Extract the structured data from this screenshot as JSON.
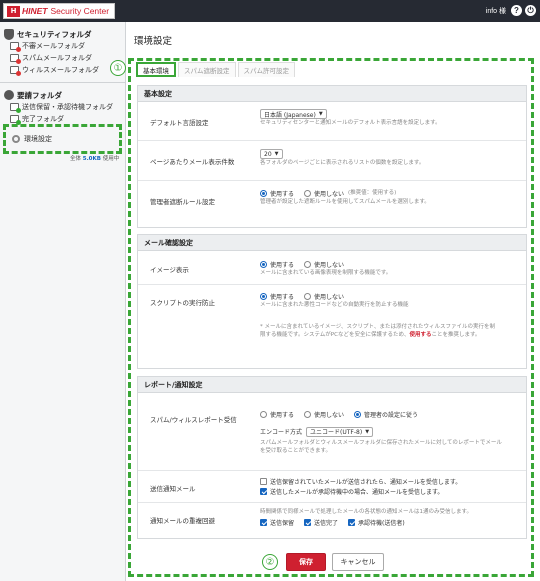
{
  "header": {
    "logo_mark": "H",
    "brand": "HINET",
    "product": "Security Center",
    "user": "info 様",
    "help_icon": "help-icon",
    "logout_icon": "power-icon"
  },
  "sidebar": {
    "security_title": "セキュリティフォルダ",
    "security_items": [
      "不審メールフォルダ",
      "スパムメールフォルダ",
      "ウィルスメールフォルダ"
    ],
    "approval_title": "要請フォルダ",
    "approval_items": [
      "送信保留・承認待機フォルダ",
      "完了フォルダ"
    ],
    "settings": "環境設定",
    "usage_prefix": "全体",
    "usage_value": "5.0KB",
    "usage_suffix": "使用中"
  },
  "main": {
    "title": "環境設定",
    "tabs": [
      "基本環境",
      "スパム遮断設定",
      "スパム許可設定"
    ],
    "basic": {
      "heading": "基本設定",
      "language_label": "デフォルト言語設定",
      "language_value": "日本語 (Japanese)",
      "language_hint": "セキュリティセンターと通知メールのデフォルト表示言語を設定します。",
      "per_page_label": "ページあたりメール表示件数",
      "per_page_value": "20",
      "per_page_hint": "各フォルダのページごとに表示されるリストの個数を設定します。",
      "admin_rule_label": "管理者遮断ルール設定",
      "admin_rule_use": "使用する",
      "admin_rule_nouse": "使用しない",
      "admin_rule_note": "(推奨値：使用する)",
      "admin_rule_hint": "管理者が設定した遮断ルールを使用してスパムメールを選別します。"
    },
    "mail_check": {
      "heading": "メール確認設定",
      "image_label": "イメージ表示",
      "image_use": "使用する",
      "image_nouse": "使用しない",
      "image_hint": "メールに含まれている画像表現を制限する機能です。",
      "script_label": "スクリプトの実行防止",
      "script_use": "使用する",
      "script_nouse": "使用しない",
      "script_hint": "メールに含まれた悪性コードなどの自動実行を防止する機能",
      "note_line1": "* メールに含まれているイメージ、スクリプト、または添付されたウィルスファイルの実行を制",
      "note_line2a": "限する機能です。システムがPCなどを安全に保護するため、",
      "note_link": "使用する",
      "note_line2b": "ことを推奨します。"
    },
    "report": {
      "heading": "レポート/通知設定",
      "report_label": "スパム/ウィルスレポート受信",
      "report_use": "使用する",
      "report_nouse": "使用しない",
      "report_admin": "管理者の設定に従う",
      "encoding_label": "エンコード方式",
      "encoding_value": "ユニコード(UTF-8)",
      "report_hint1": "スパムメールフォルダとウィルスメールフォルダに保存されたメールに対してのレポートでメール",
      "report_hint2": "を受け取ることができます。",
      "send_notice_label": "送信通知メール",
      "send_notice_opt1": "送信保留されていたメールが送信されたら、通知メールを受信します。",
      "send_notice_opt2": "送信したメールが承認待機中の場合、通知メールを受信します。",
      "duplicate_label": "通知メールの重複回避",
      "duplicate_hint": "時間関係で同様メールで処理したメールの各状態の通知メールは1通のみ受信します。",
      "duplicate_opts": [
        "送信保留",
        "送信完了",
        "承認待機(送信者)"
      ]
    },
    "save_button": "保存",
    "cancel_button": "キャンセル"
  },
  "annotations": {
    "marker1": "①",
    "marker2": "②"
  },
  "colors": {
    "accent_green": "#3aa637",
    "brand_red": "#cf2030",
    "header_bg": "#262a33"
  }
}
